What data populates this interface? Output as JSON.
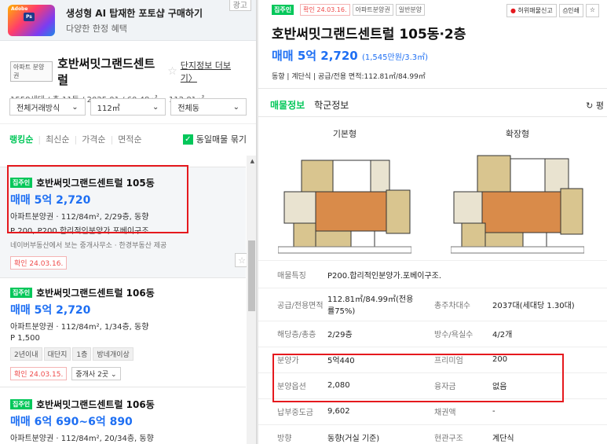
{
  "ad": {
    "title": "생성형 AI 탑재한 포토샵 구매하기",
    "subtitle": "다양한 한정 혜택",
    "close": "광고"
  },
  "complex": {
    "type_tag": "아파트 분양권",
    "name": "호반써밋그랜드센트럴",
    "detail_link": "단지정보 더보기",
    "info": "1558세대 / 총 11동 / 2025.01 / 60.48㎡ ~ 112.81㎡"
  },
  "filters": [
    {
      "label": "전체거래방식"
    },
    {
      "label": "112㎡"
    },
    {
      "label": "전체동"
    }
  ],
  "sort": {
    "items": [
      "랭킹순",
      "최신순",
      "가격순",
      "면적순"
    ],
    "same_listing": "동일매물 묶기"
  },
  "listings": [
    {
      "badge": "집주인",
      "name": "호반써밋그랜드센트럴 105동",
      "price": "매매 5억 2,720",
      "spec": "아파트분양권 · 112/84m², 2/29층, 동향",
      "desc": "P 200, P200.합리적인분양가.포베이구조.",
      "agent": "네이버부동산에서 보는 중개사무소 · 한경부동산 제공",
      "confirm": "확인 24.03.16."
    },
    {
      "badge": "집주인",
      "name": "호반써밋그랜드센트럴 106동",
      "price": "매매 5억 2,720",
      "spec": "아파트분양권 · 112/84m², 1/34층, 동향",
      "desc": "P 1,500",
      "chips": [
        "2년이내",
        "대단지",
        "1층",
        "방네개이상"
      ],
      "confirm": "확인 24.03.15.",
      "broker": "중개사 2곳"
    },
    {
      "badge": "집주인",
      "name": "호반써밋그랜드센트럴 106동",
      "price": "매매 6억 690~6억 890",
      "spec": "아파트분양권 · 112/84m², 20/34층, 동향"
    }
  ],
  "detail": {
    "tags": {
      "badge": "집주인",
      "confirm": "확인 24.03.16.",
      "type1": "아파트분양권",
      "type2": "일반분양"
    },
    "actions": {
      "report": "허위매물신고",
      "print": "인쇄"
    },
    "title": "호반써밋그랜드센트럴 105동·2층",
    "price": "매매 5억 2,720",
    "price_per": "(1,545만원/3.3㎡)",
    "info": "동향 | 계단식 | 공급/전용 면적:112.81㎡/84.99㎡",
    "tabs": [
      "매물정보",
      "학군정보"
    ],
    "tab_right": "평",
    "plans": [
      {
        "title": "기본형"
      },
      {
        "title": "확장형"
      }
    ],
    "rows": [
      {
        "k": "매물특징",
        "v": "P200.합리적인분양가.포베이구조."
      },
      {
        "k": "공급/전용면적",
        "v": "112.81㎡/84.99㎡(전용률75%)",
        "k2": "총주차대수",
        "v2": "2037대(세대당 1.30대)"
      },
      {
        "k": "해당층/총층",
        "v": "2/29층",
        "k2": "방수/욕실수",
        "v2": "4/2개"
      },
      {
        "k": "분양가",
        "v": "5억440",
        "k2": "프리미엄",
        "v2": "200"
      },
      {
        "k": "분양옵션",
        "v": "2,080",
        "k2": "융자금",
        "v2": "없음"
      },
      {
        "k": "납부중도금",
        "v": "9,602",
        "k2": "채권액",
        "v2": "-"
      },
      {
        "k": "방향",
        "v": "동향(거실 기준)",
        "k2": "현관구조",
        "v2": "계단식"
      }
    ]
  }
}
